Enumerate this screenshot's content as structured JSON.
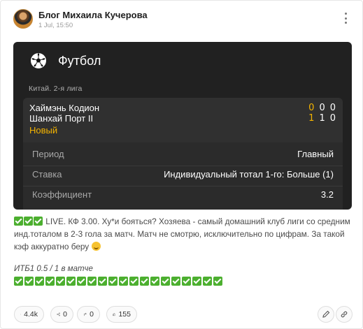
{
  "post": {
    "author": "Блог Михаила Кучерова",
    "date": "1 Jul, 15:50"
  },
  "card": {
    "sport": "Футбол",
    "league": "Китай. 2-я лига",
    "team1": "Хаймэнь Кодион",
    "team2": "Шанхай Порт II",
    "status": "Новый",
    "scores": {
      "team1": [
        "0",
        "0",
        "0"
      ],
      "team2": [
        "1",
        "1",
        "0"
      ]
    },
    "details": [
      {
        "label": "Период",
        "value": "Главный"
      },
      {
        "label": "Ставка",
        "value": "Индивидуальный тотал 1-го: Больше (1)"
      },
      {
        "label": "Коэффициент",
        "value": "3.2"
      }
    ]
  },
  "body": {
    "text": " LIVE. КФ 3.00. Ху*и бояться? Хозяева - самый домашний клуб лиги со средним инд.тоталом в 2-3 гола за матч. Матч не смотрю, исключительно по цифрам. За такой кэф аккуратно беру ",
    "itb_line": "ИТБ1 0.5 / 1 в матче",
    "check_count": 20
  },
  "footer": {
    "views": "4.4k",
    "reposts": "0",
    "shares": "0",
    "likes": "155"
  },
  "icons": [
    "avatar",
    "more-vertical-icon",
    "soccer-ball-icon",
    "check-emoji-icon",
    "smile-emoji-icon",
    "eye-icon",
    "repost-icon",
    "share-icon",
    "thumbs-up-icon",
    "pencil-icon",
    "link-icon"
  ],
  "colors": {
    "card_bg": "#212121",
    "accent_yellow": "#f5b400",
    "check_green": "#4caf2f"
  }
}
